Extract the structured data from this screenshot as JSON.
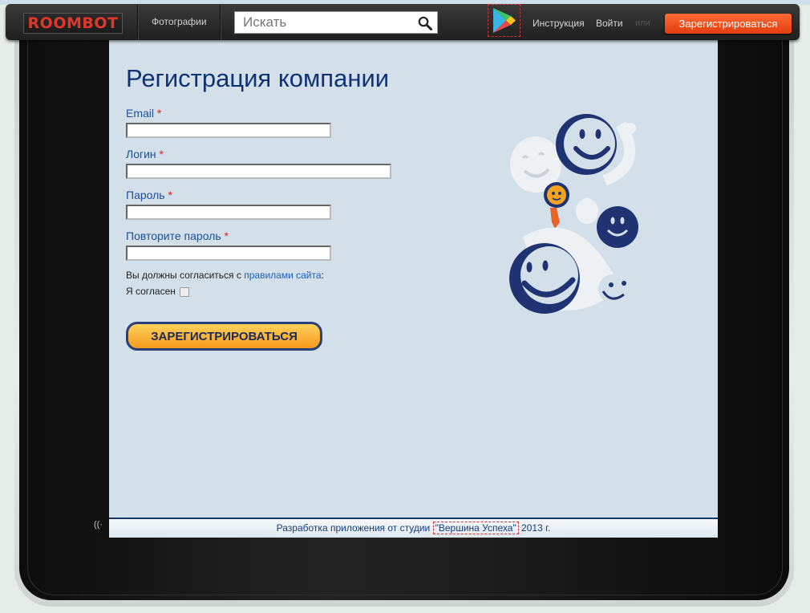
{
  "navbar": {
    "logo": "ROOMBOT",
    "photos": "Фотографии",
    "search_placeholder": "Искать",
    "instructions": "Инструкция",
    "login": "Войти",
    "or": "или",
    "register": "Зарегистрироваться"
  },
  "form": {
    "title": "Регистрация компании",
    "email_label": "Email",
    "login_label": "Логин",
    "password_label": "Пароль",
    "repeat_label": "Повторите пароль",
    "required_mark": "*",
    "terms_prefix": "Вы должны согласиться с",
    "terms_link": "правилами сайта",
    "terms_suffix": ":",
    "agree_label": "Я согласен",
    "submit": "ЗАРЕГИСТРИРОВАТЬСЯ"
  },
  "footer": {
    "prefix": "Разработка приложения от студии",
    "studio": "\"Вершина Успеха\"",
    "suffix": "2013 г."
  },
  "colors": {
    "accent": "#e43d0d",
    "title": "#0f3275",
    "content_bg": "#d3e0ea"
  },
  "icons": {
    "search": "search-icon",
    "google_play": "google-play-icon",
    "side": "signal-icon"
  }
}
